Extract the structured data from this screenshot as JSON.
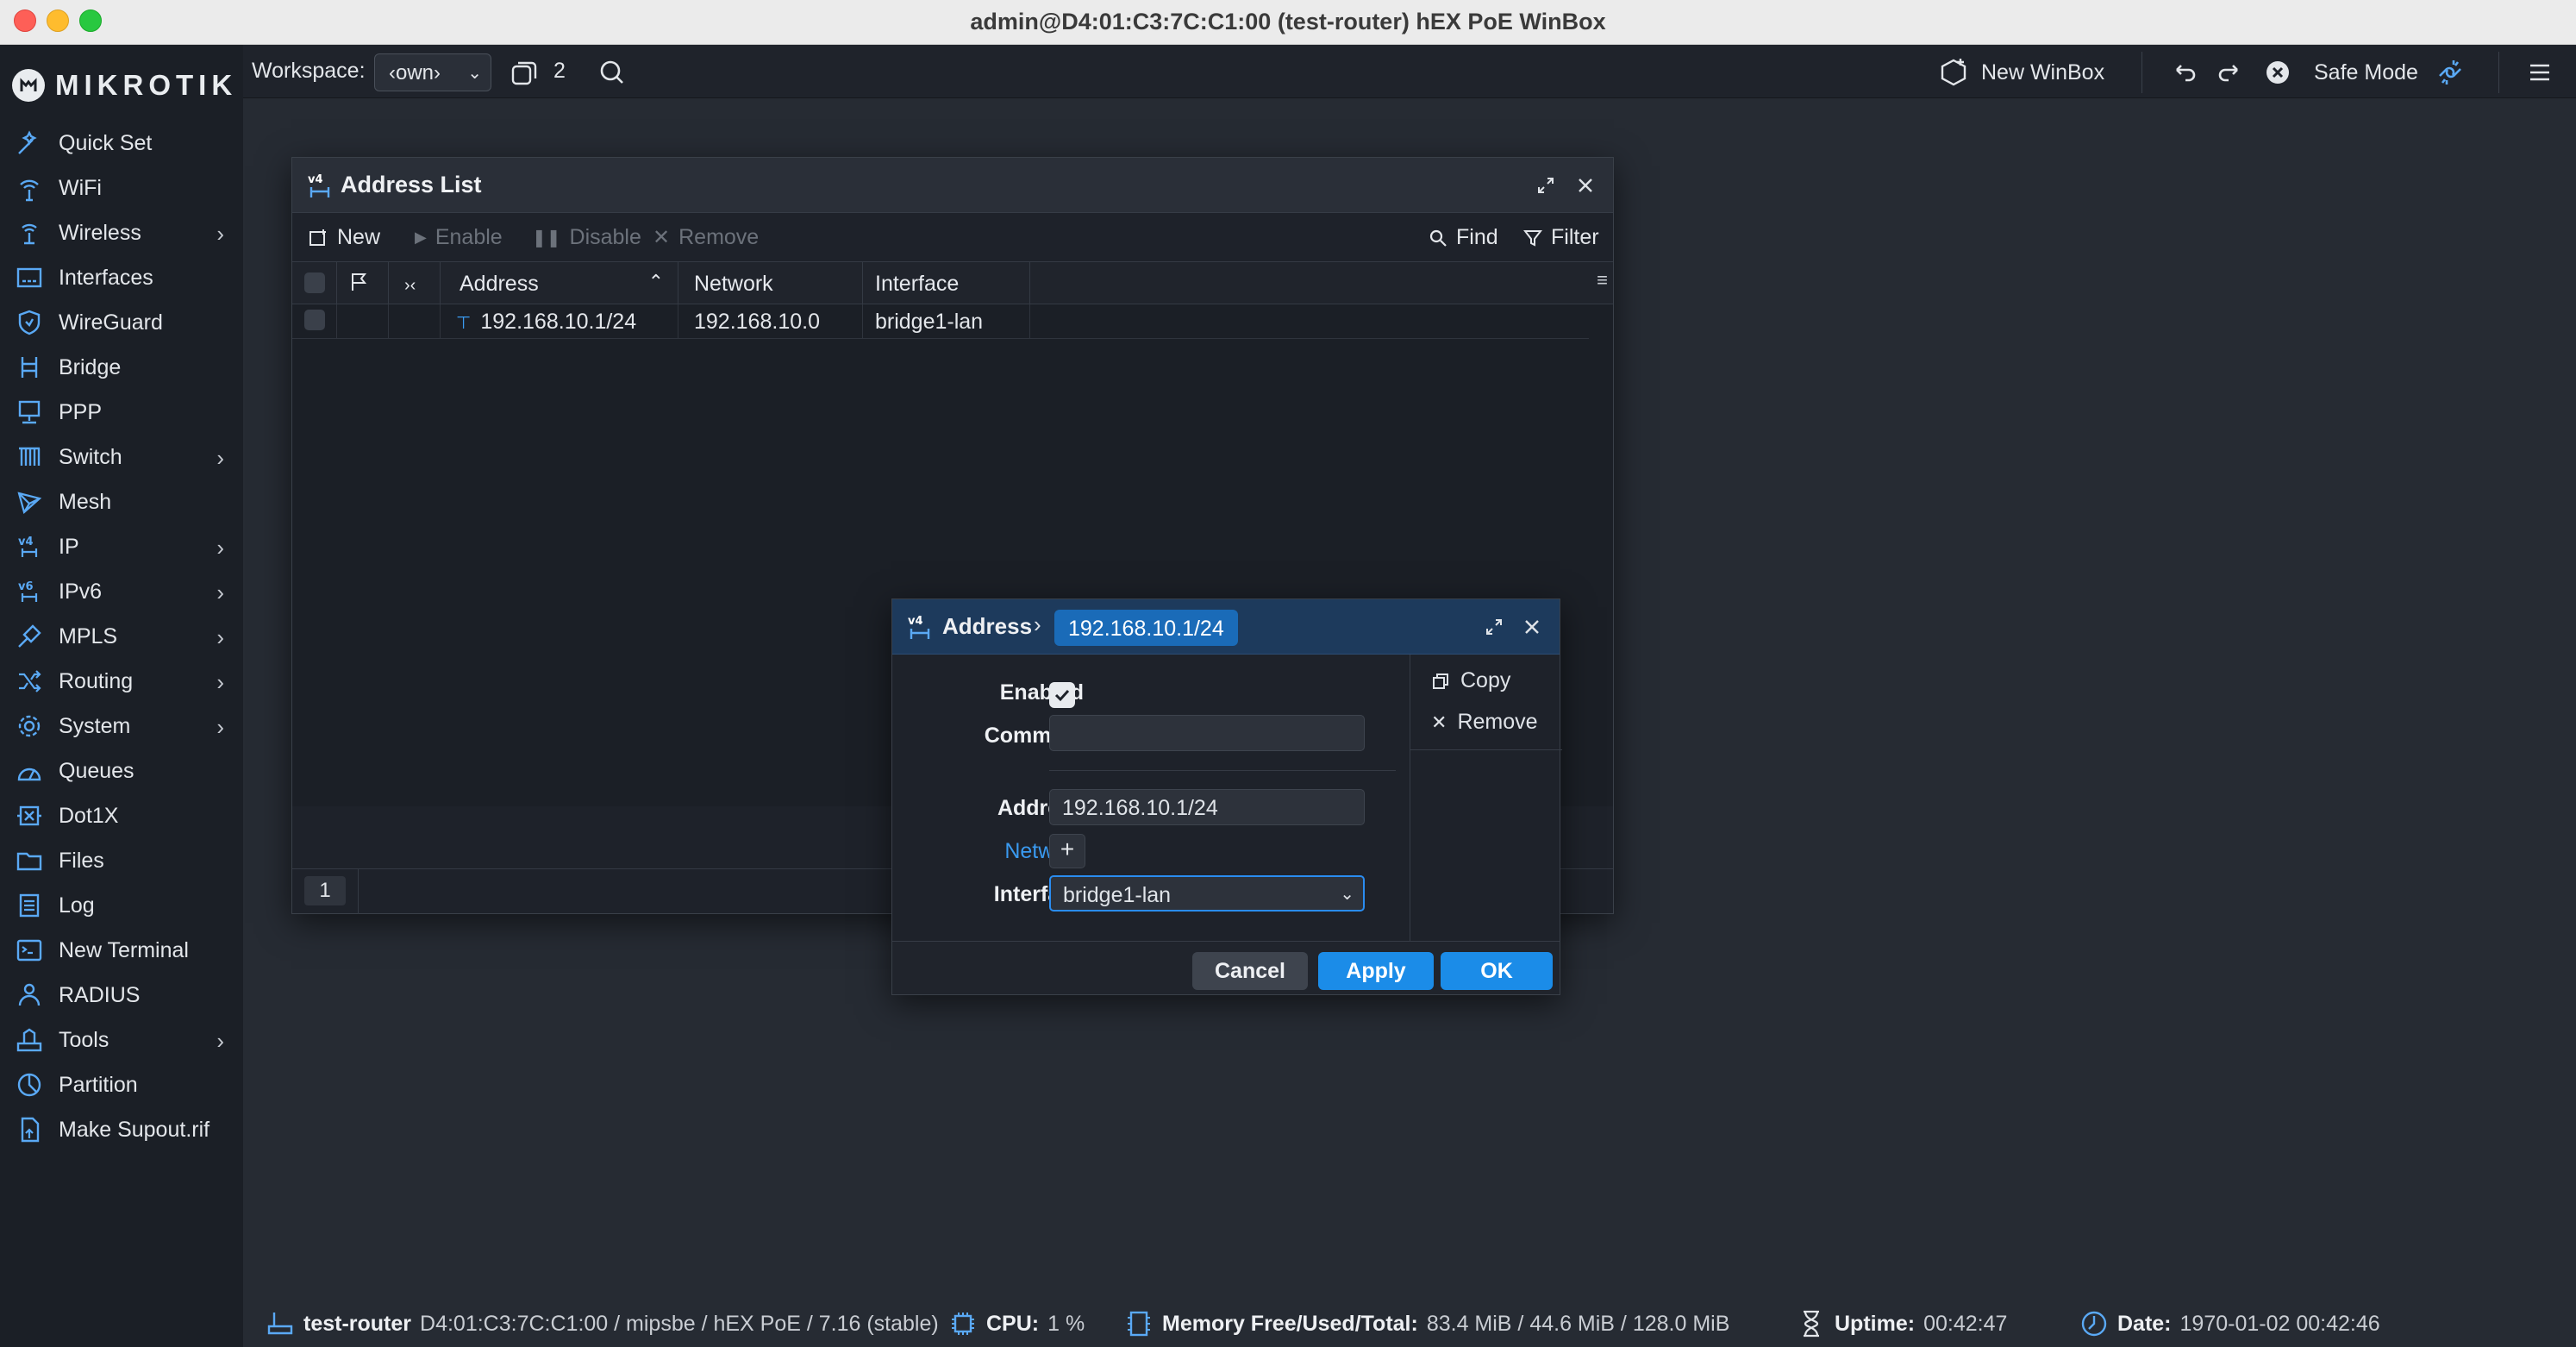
{
  "window": {
    "title": "admin@D4:01:C3:7C:C1:00 (test-router) hEX PoE WinBox"
  },
  "brand": {
    "logo_text": "MIKROTIK"
  },
  "sidebar": {
    "items": [
      {
        "label": "Quick Set",
        "icon": "quick-set-icon",
        "submenu": false
      },
      {
        "label": "WiFi",
        "icon": "wifi-icon",
        "submenu": false
      },
      {
        "label": "Wireless",
        "icon": "wireless-icon",
        "submenu": true
      },
      {
        "label": "Interfaces",
        "icon": "interfaces-icon",
        "submenu": false
      },
      {
        "label": "WireGuard",
        "icon": "wireguard-icon",
        "submenu": false
      },
      {
        "label": "Bridge",
        "icon": "bridge-icon",
        "submenu": false
      },
      {
        "label": "PPP",
        "icon": "ppp-icon",
        "submenu": false
      },
      {
        "label": "Switch",
        "icon": "switch-icon",
        "submenu": true
      },
      {
        "label": "Mesh",
        "icon": "mesh-icon",
        "submenu": false
      },
      {
        "label": "IP",
        "icon": "ip-icon",
        "submenu": true
      },
      {
        "label": "IPv6",
        "icon": "ipv6-icon",
        "submenu": true
      },
      {
        "label": "MPLS",
        "icon": "mpls-icon",
        "submenu": true
      },
      {
        "label": "Routing",
        "icon": "routing-icon",
        "submenu": true
      },
      {
        "label": "System",
        "icon": "system-icon",
        "submenu": true
      },
      {
        "label": "Queues",
        "icon": "queues-icon",
        "submenu": false
      },
      {
        "label": "Dot1X",
        "icon": "dot1x-icon",
        "submenu": false
      },
      {
        "label": "Files",
        "icon": "files-icon",
        "submenu": false
      },
      {
        "label": "Log",
        "icon": "log-icon",
        "submenu": false
      },
      {
        "label": "New Terminal",
        "icon": "terminal-icon",
        "submenu": false
      },
      {
        "label": "RADIUS",
        "icon": "radius-icon",
        "submenu": false
      },
      {
        "label": "Tools",
        "icon": "tools-icon",
        "submenu": true
      },
      {
        "label": "Partition",
        "icon": "partition-icon",
        "submenu": false
      },
      {
        "label": "Make Supout.rif",
        "icon": "supout-icon",
        "submenu": false
      }
    ]
  },
  "topbar": {
    "workspace_label": "Workspace:",
    "workspace_value": "‹own›",
    "windows_count": "2",
    "new_winbox": "New WinBox",
    "safe_mode": "Safe Mode"
  },
  "address_list": {
    "title": "Address List",
    "toolbar": {
      "new": "New",
      "enable": "Enable",
      "disable": "Disable",
      "remove": "Remove",
      "find": "Find",
      "filter": "Filter"
    },
    "columns": [
      "Address",
      "Network",
      "Interface"
    ],
    "rows": [
      {
        "address": "192.168.10.1/24",
        "network": "192.168.10.0",
        "interface": "bridge1-lan"
      }
    ],
    "item_count": "1"
  },
  "dialog": {
    "crumb": "Address",
    "crumb_value": "192.168.10.1/24",
    "fields": {
      "enabled_label": "Enabled",
      "enabled": true,
      "comment_label": "Comment",
      "comment_value": "",
      "address_label": "Address",
      "address_value": "192.168.10.1/24",
      "network_label": "Network",
      "interface_label": "Interface",
      "interface_value": "bridge1-lan"
    },
    "actions": {
      "copy": "Copy",
      "remove": "Remove"
    },
    "buttons": {
      "cancel": "Cancel",
      "apply": "Apply",
      "ok": "OK"
    }
  },
  "statusbar": {
    "router_name": "test-router",
    "router_info": "D4:01:C3:7C:C1:00 / mipsbe / hEX PoE / 7.16 (stable)",
    "cpu_label": "CPU:",
    "cpu_value": "1 %",
    "memory_label": "Memory Free/Used/Total:",
    "memory_value": "83.4 MiB / 44.6 MiB / 128.0 MiB",
    "uptime_label": "Uptime:",
    "uptime_value": "00:42:47",
    "date_label": "Date:",
    "date_value": "1970-01-02 00:42:46"
  },
  "colors": {
    "accent": "#1b8ce8",
    "sidebar_bg": "#1b1f26",
    "workspace_bg": "#262b33",
    "dialog_title_bg": "#1d3a5c",
    "link": "#3a9af0"
  }
}
